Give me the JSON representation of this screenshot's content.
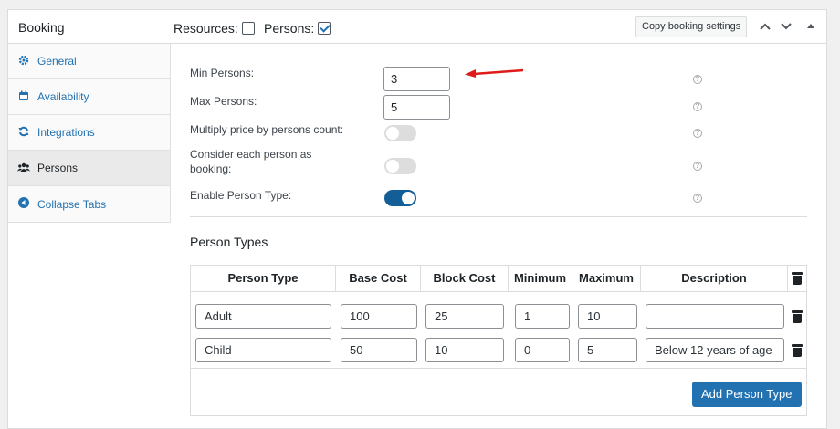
{
  "header": {
    "title": "Booking",
    "resources_label": "Resources:",
    "resources_checked": false,
    "persons_label": "Persons:",
    "persons_checked": true,
    "copy_button": "Copy booking settings"
  },
  "sidebar": {
    "items": [
      {
        "label": "General",
        "icon": "gear-icon",
        "active": false
      },
      {
        "label": "Availability",
        "icon": "calendar-icon",
        "active": false
      },
      {
        "label": "Integrations",
        "icon": "sync-icon",
        "active": false
      },
      {
        "label": "Persons",
        "icon": "users-icon",
        "active": true
      },
      {
        "label": "Collapse Tabs",
        "icon": "collapse-icon",
        "active": false
      }
    ]
  },
  "fields": {
    "min_persons": {
      "label": "Min Persons:",
      "value": "3"
    },
    "max_persons": {
      "label": "Max Persons:",
      "value": "5"
    },
    "multiply_price": {
      "label": "Multiply price by persons count:",
      "on": false
    },
    "consider_each": {
      "label_line1": "Consider each person as",
      "label_line2": "booking:",
      "on": false
    },
    "enable_type": {
      "label": "Enable Person Type:",
      "on": true
    }
  },
  "person_types": {
    "title": "Person Types",
    "columns": [
      "Person Type",
      "Base Cost",
      "Block Cost",
      "Minimum",
      "Maximum",
      "Description"
    ],
    "rows": [
      {
        "type": "Adult",
        "base": "100",
        "block": "25",
        "min": "1",
        "max": "10",
        "desc": ""
      },
      {
        "type": "Child",
        "base": "50",
        "block": "10",
        "min": "0",
        "max": "5",
        "desc": "Below 12 years of age"
      }
    ],
    "add_button": "Add Person Type"
  },
  "colors": {
    "accent": "#2271b1",
    "toggle_on": "#135e96",
    "arrow": "#e01b1b"
  }
}
